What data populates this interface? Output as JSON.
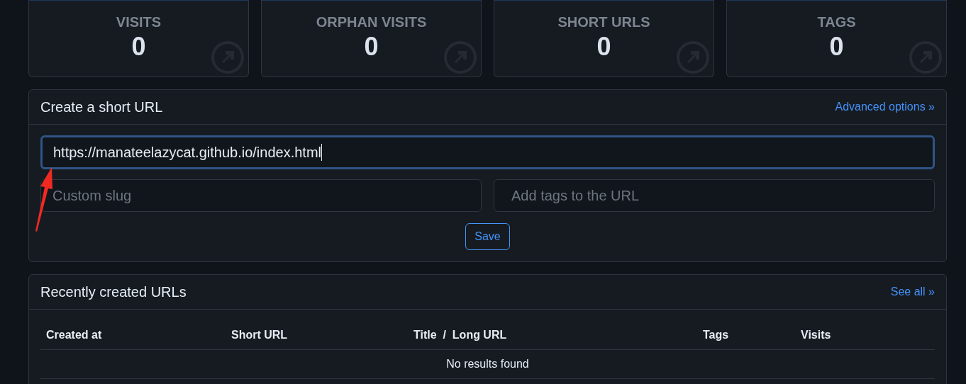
{
  "stats": [
    {
      "label": "VISITS",
      "value": "0"
    },
    {
      "label": "ORPHAN VISITS",
      "value": "0"
    },
    {
      "label": "SHORT URLS",
      "value": "0"
    },
    {
      "label": "TAGS",
      "value": "0"
    }
  ],
  "create": {
    "title": "Create a short URL",
    "advanced_link": "Advanced options »",
    "url_field": {
      "value": "https://manateelazycat.github.io/index.html"
    },
    "slug_field": {
      "placeholder": "Custom slug"
    },
    "tags_field": {
      "placeholder": "Add tags to the URL"
    },
    "save_button": "Save"
  },
  "recent": {
    "title": "Recently created URLs",
    "see_all_link": "See all »",
    "table": {
      "columns": [
        "Created at",
        "Short URL",
        "Title  /  Long URL",
        "Tags",
        "Visits"
      ],
      "empty_message": "No results found"
    }
  }
}
